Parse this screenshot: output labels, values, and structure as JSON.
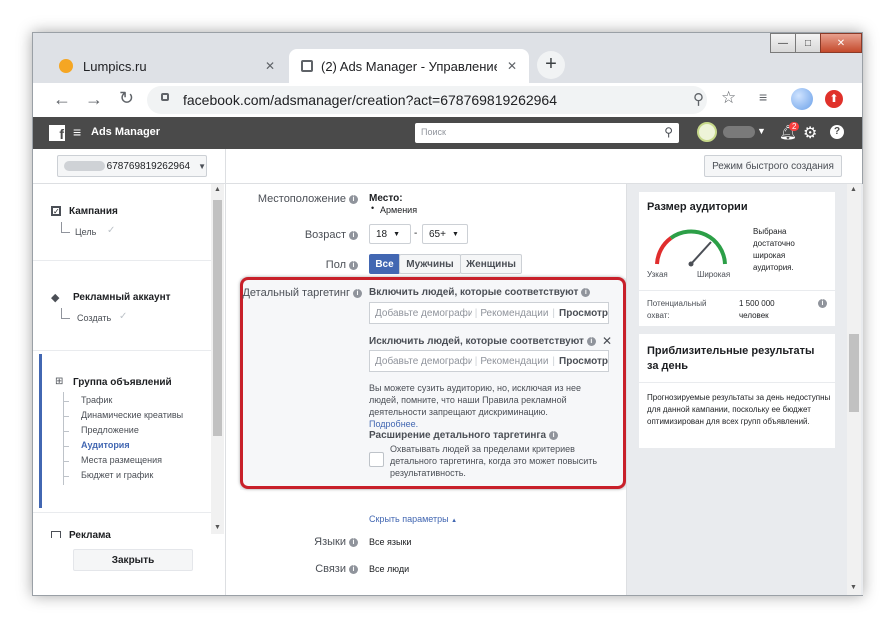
{
  "window": {
    "minimize": "—",
    "maximize": "□",
    "close": "✕"
  },
  "tabs": [
    {
      "label": "Lumpics.ru",
      "close": "✕"
    },
    {
      "label": "(2) Ads Manager - Управление р",
      "close": "✕"
    }
  ],
  "new_tab": "+",
  "url": "facebook.com/adsmanager/creation?act=678769819262964",
  "fb": {
    "logo": "f",
    "title": "Ads Manager",
    "search_placeholder": "Поиск",
    "notif_count": "2"
  },
  "account": {
    "selector": "678769819262964"
  },
  "quick_create": "Режим быстрого создания",
  "sidebar": {
    "campaign": "Кампания",
    "campaign_goal": "Цель",
    "ad_account": "Рекламный аккаунт",
    "ad_account_create": "Создать",
    "ad_group": "Группа объявлений",
    "ad_group_items": [
      "Трафик",
      "Динамические креативы",
      "Предложение",
      "Аудитория",
      "Места размещения",
      "Бюджет и график"
    ],
    "ad": "Реклама",
    "close_button": "Закрыть"
  },
  "form": {
    "location_label": "Местоположение",
    "location_title": "Место:",
    "location_value": "Армения",
    "age_label": "Возраст",
    "age_min": "18",
    "age_dash": "-",
    "age_max": "65+",
    "gender_label": "Пол",
    "gender_options": [
      "Все",
      "Мужчины",
      "Женщины"
    ],
    "detailed_label": "Детальный таргетинг",
    "include_title": "Включить людей, которые соответствуют",
    "exclude_title": "Исключить людей, которые соответствуют",
    "input_placeholder": "Добавьте демографические",
    "recommendations": "Рекомендации",
    "browse": "Просмотр",
    "note_text": "Вы можете сузить аудиторию, но, исключая из нее людей, помните, что наши Правила рекламной деятельности запрещают дискриминацию.",
    "note_link": "Подробнее.",
    "expansion_title": "Расширение детального таргетинга",
    "expansion_text": "Охватывать людей за пределами критериев детального таргетинга, когда это может повысить результативность.",
    "hide_params": "Скрыть параметры",
    "languages_label": "Языки",
    "languages_value": "Все языки",
    "connections_label": "Связи",
    "connections_value": "Все люди"
  },
  "audience": {
    "title": "Размер аудитории",
    "gauge_min": "Узкая",
    "gauge_max": "Широкая",
    "description": "Выбрана достаточно широкая аудитория.",
    "potential_label": "Потенциальный охват:",
    "potential_value": "1 500 000 человек"
  },
  "estimates": {
    "title": "Приблизительные результаты за день",
    "text": "Прогнозируемые результаты за день недоступны для данной кампании, поскольку ее бюджет оптимизирован для всех групп объявлений."
  }
}
